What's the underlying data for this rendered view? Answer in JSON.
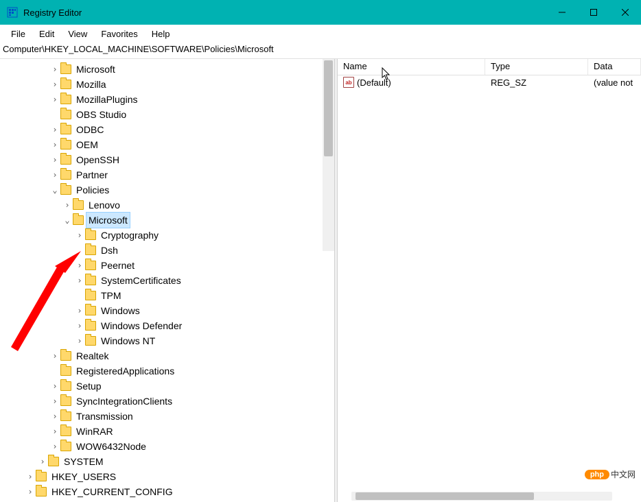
{
  "window": {
    "title": "Registry Editor"
  },
  "menu": {
    "file": "File",
    "edit": "Edit",
    "view": "View",
    "favorites": "Favorites",
    "help": "Help"
  },
  "path": "Computer\\HKEY_LOCAL_MACHINE\\SOFTWARE\\Policies\\Microsoft",
  "tree": [
    {
      "indent": 3,
      "exp": ">",
      "label": "Microsoft"
    },
    {
      "indent": 3,
      "exp": ">",
      "label": "Mozilla"
    },
    {
      "indent": 3,
      "exp": ">",
      "label": "MozillaPlugins"
    },
    {
      "indent": 3,
      "exp": "",
      "label": "OBS Studio"
    },
    {
      "indent": 3,
      "exp": ">",
      "label": "ODBC"
    },
    {
      "indent": 3,
      "exp": ">",
      "label": "OEM"
    },
    {
      "indent": 3,
      "exp": ">",
      "label": "OpenSSH"
    },
    {
      "indent": 3,
      "exp": ">",
      "label": "Partner"
    },
    {
      "indent": 3,
      "exp": "v",
      "label": "Policies"
    },
    {
      "indent": 4,
      "exp": ">",
      "label": "Lenovo"
    },
    {
      "indent": 4,
      "exp": "v",
      "label": "Microsoft",
      "selected": true
    },
    {
      "indent": 5,
      "exp": ">",
      "label": "Cryptography"
    },
    {
      "indent": 5,
      "exp": "",
      "label": "Dsh"
    },
    {
      "indent": 5,
      "exp": ">",
      "label": "Peernet"
    },
    {
      "indent": 5,
      "exp": ">",
      "label": "SystemCertificates"
    },
    {
      "indent": 5,
      "exp": "",
      "label": "TPM"
    },
    {
      "indent": 5,
      "exp": ">",
      "label": "Windows"
    },
    {
      "indent": 5,
      "exp": ">",
      "label": "Windows Defender"
    },
    {
      "indent": 5,
      "exp": ">",
      "label": "Windows NT"
    },
    {
      "indent": 3,
      "exp": ">",
      "label": "Realtek"
    },
    {
      "indent": 3,
      "exp": "",
      "label": "RegisteredApplications"
    },
    {
      "indent": 3,
      "exp": ">",
      "label": "Setup"
    },
    {
      "indent": 3,
      "exp": ">",
      "label": "SyncIntegrationClients"
    },
    {
      "indent": 3,
      "exp": ">",
      "label": "Transmission"
    },
    {
      "indent": 3,
      "exp": ">",
      "label": "WinRAR"
    },
    {
      "indent": 3,
      "exp": ">",
      "label": "WOW6432Node"
    },
    {
      "indent": 2,
      "exp": ">",
      "label": "SYSTEM"
    },
    {
      "indent": 1,
      "exp": ">",
      "label": "HKEY_USERS"
    },
    {
      "indent": 1,
      "exp": ">",
      "label": "HKEY_CURRENT_CONFIG"
    }
  ],
  "columns": {
    "name": "Name",
    "type": "Type",
    "data": "Data"
  },
  "rows": [
    {
      "icon": "ab",
      "name": "(Default)",
      "type": "REG_SZ",
      "data": "(value not"
    }
  ],
  "watermark": {
    "pill": "php",
    "text": "中文网"
  }
}
